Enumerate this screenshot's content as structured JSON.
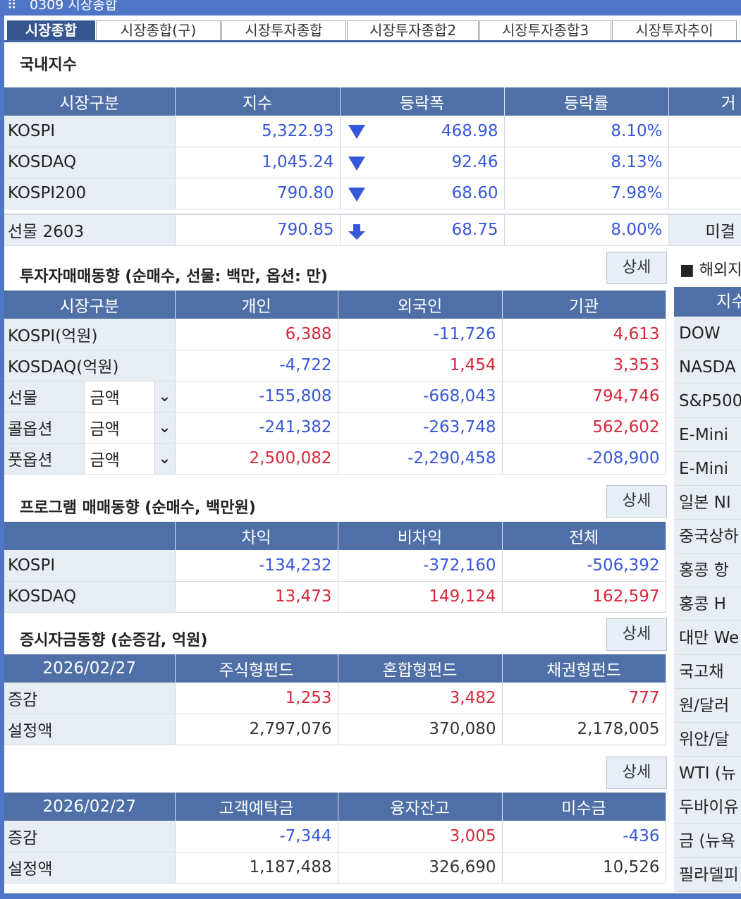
{
  "window": {
    "title": "0309 시장종합"
  },
  "tabs": [
    "시장종합",
    "시장종합(구)",
    "시장투자종합",
    "시장투자종합2",
    "시장투자종합3",
    "시장투자추이"
  ],
  "domestic": {
    "title": "국내지수",
    "headers": [
      "시장구분",
      "지수",
      "등락폭",
      "등락률",
      "거"
    ],
    "rows": [
      {
        "name": "KOSPI",
        "index": "5,322.93",
        "change": "468.98",
        "rate": "8.10%"
      },
      {
        "name": "KOSDAQ",
        "index": "1,045.24",
        "change": "92.46",
        "rate": "8.13%"
      },
      {
        "name": "KOSPI200",
        "index": "790.80",
        "change": "68.60",
        "rate": "7.98%"
      }
    ],
    "futures": {
      "name": "선물 2603",
      "index": "790.85",
      "change": "68.75",
      "rate": "8.00%",
      "extra": "미결"
    }
  },
  "investor": {
    "title": "투자자매매동향 (순매수, 선물: 백만, 옵션: 만)",
    "detail": "상세",
    "headers": [
      "시장구분",
      "개인",
      "외국인",
      "기관"
    ],
    "rows": [
      {
        "name": "KOSPI(억원)",
        "v1": "6,388",
        "v2": "-11,726",
        "v3": "4,613"
      },
      {
        "name": "KOSDAQ(억원)",
        "v1": "-4,722",
        "v2": "1,454",
        "v3": "3,353"
      }
    ],
    "option_rows": [
      {
        "name": "선물",
        "select": "금액",
        "v1": "-155,808",
        "v2": "-668,043",
        "v3": "794,746"
      },
      {
        "name": "콜옵션",
        "select": "금액",
        "v1": "-241,382",
        "v2": "-263,748",
        "v3": "562,602"
      },
      {
        "name": "풋옵션",
        "select": "금액",
        "v1": "2,500,082",
        "v2": "-2,290,458",
        "v3": "-208,900"
      }
    ]
  },
  "program": {
    "title": "프로그램 매매동향 (순매수, 백만원)",
    "detail": "상세",
    "headers": [
      "",
      "차익",
      "비차익",
      "전체"
    ],
    "rows": [
      {
        "name": "KOSPI",
        "v1": "-134,232",
        "v2": "-372,160",
        "v3": "-506,392"
      },
      {
        "name": "KOSDAQ",
        "v1": "13,473",
        "v2": "149,124",
        "v3": "162,597"
      }
    ]
  },
  "funds": {
    "title": "증시자금동향 (순증감, 억원)",
    "detail": "상세",
    "headers": [
      "2026/02/27",
      "주식형펀드",
      "혼합형펀드",
      "채권형펀드"
    ],
    "rows": [
      {
        "name": "증감",
        "v1": "1,253",
        "v2": "3,482",
        "v3": "777"
      },
      {
        "name": "설정액",
        "v1": "2,797,076",
        "v2": "370,080",
        "v3": "2,178,005"
      }
    ]
  },
  "deposits": {
    "detail": "상세",
    "headers": [
      "2026/02/27",
      "고객예탁금",
      "융자잔고",
      "미수금"
    ],
    "rows": [
      {
        "name": "증감",
        "v1": "-7,344",
        "v2": "3,005",
        "v3": "-436"
      },
      {
        "name": "설정액",
        "v1": "1,187,488",
        "v2": "326,690",
        "v3": "10,526"
      }
    ]
  },
  "overseas": {
    "title": "■ 해외지",
    "header": "지수",
    "rows": [
      "DOW",
      "NASDA",
      "S&P500",
      "E-Mini",
      "E-Mini",
      "일본 NI",
      "중국상하",
      "홍콩 항",
      "홍콩 H",
      "대만 We",
      "국고채",
      "원/달러",
      "위안/달",
      "WTI (뉴",
      "두바이유",
      "금 (뉴욕",
      "필라델피"
    ]
  },
  "colors": {
    "header_bg": "#4f6fa7",
    "label_bg": "#e8edf4",
    "up": "#d8263a",
    "down": "#3657d8",
    "frame": "#4f76c6"
  }
}
